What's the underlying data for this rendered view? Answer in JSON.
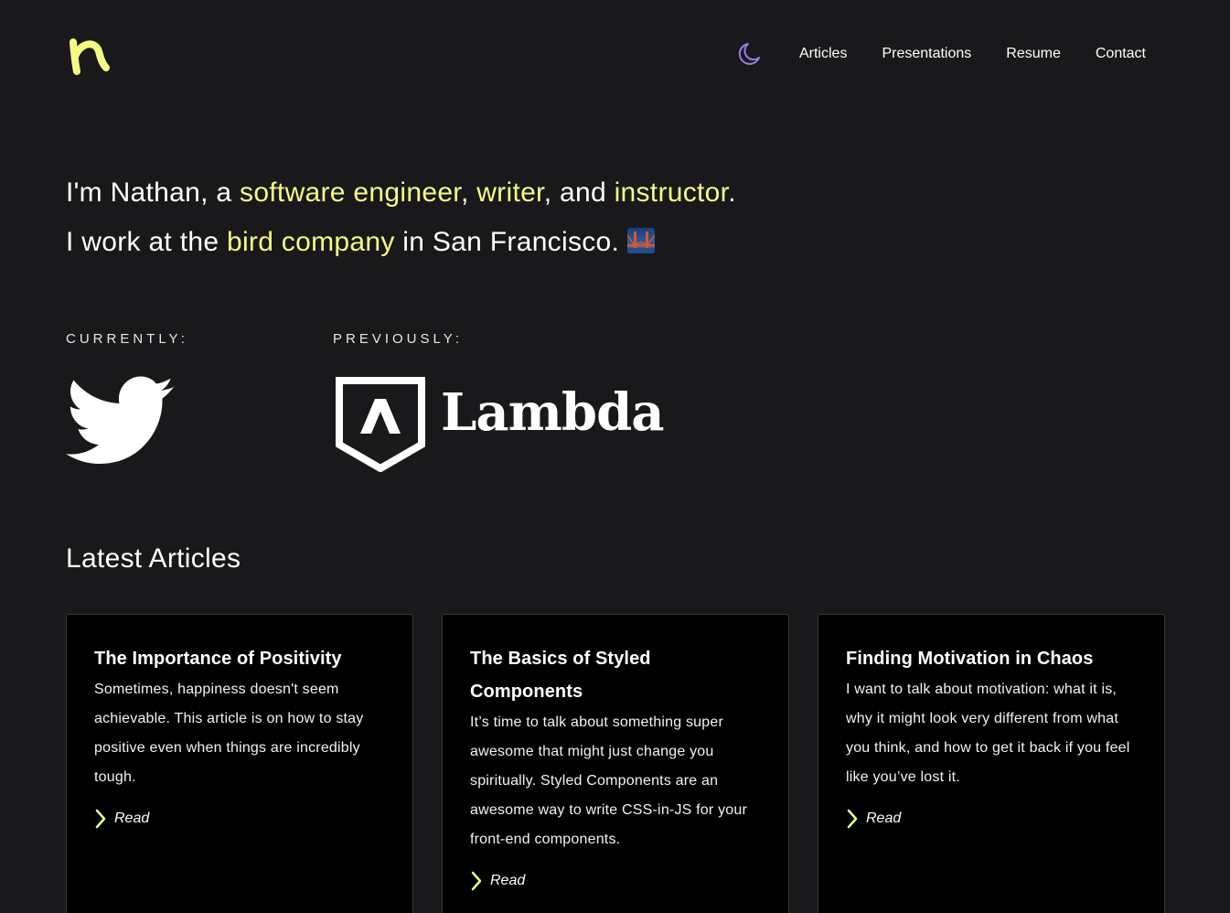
{
  "header": {
    "nav": [
      "Articles",
      "Presentations",
      "Resume",
      "Contact"
    ]
  },
  "intro": {
    "line1": {
      "pre": "I'm Nathan, a ",
      "role1": "software engineer",
      "sep1": ", ",
      "role2": "writer",
      "sep2": ", and ",
      "role3": "instructor",
      "end": "."
    },
    "line2": {
      "pre": "I work at the ",
      "company": "bird company",
      "post": " in San Francisco. "
    }
  },
  "experience": {
    "current_label": "CURRENTLY:",
    "previous_label": "PREVIOUSLY:",
    "previous_name": "Lambda"
  },
  "articles": {
    "title": "Latest Articles",
    "read_label": "Read",
    "items": [
      {
        "title": "The Importance of Positivity",
        "body": "Sometimes, happiness doesn't seem achievable. This article is on how to stay positive even when things are incredibly tough."
      },
      {
        "title": "The Basics of Styled Components",
        "body": "It’s time to talk about something super awesome that might just change you spiritually. Styled Components are an awesome way to write CSS-in-JS for your front-end components."
      },
      {
        "title": "Finding Motivation in Chaos",
        "body": "I want to talk about motivation: what it is, why it might look very different from what you think, and how to get it back if you feel like you’ve lost it."
      }
    ]
  },
  "colors": {
    "background": "#19191c",
    "accent": "#f4fc84",
    "moon": "#9b7ee8",
    "card": "#000000"
  },
  "icons": {
    "logo": "n-logo-icon",
    "theme": "moon-icon",
    "city": "golden-gate-bridge-icon",
    "current": "twitter-bird-icon",
    "previous": "lambda-shield-icon",
    "read": "chevron-right-icon"
  }
}
